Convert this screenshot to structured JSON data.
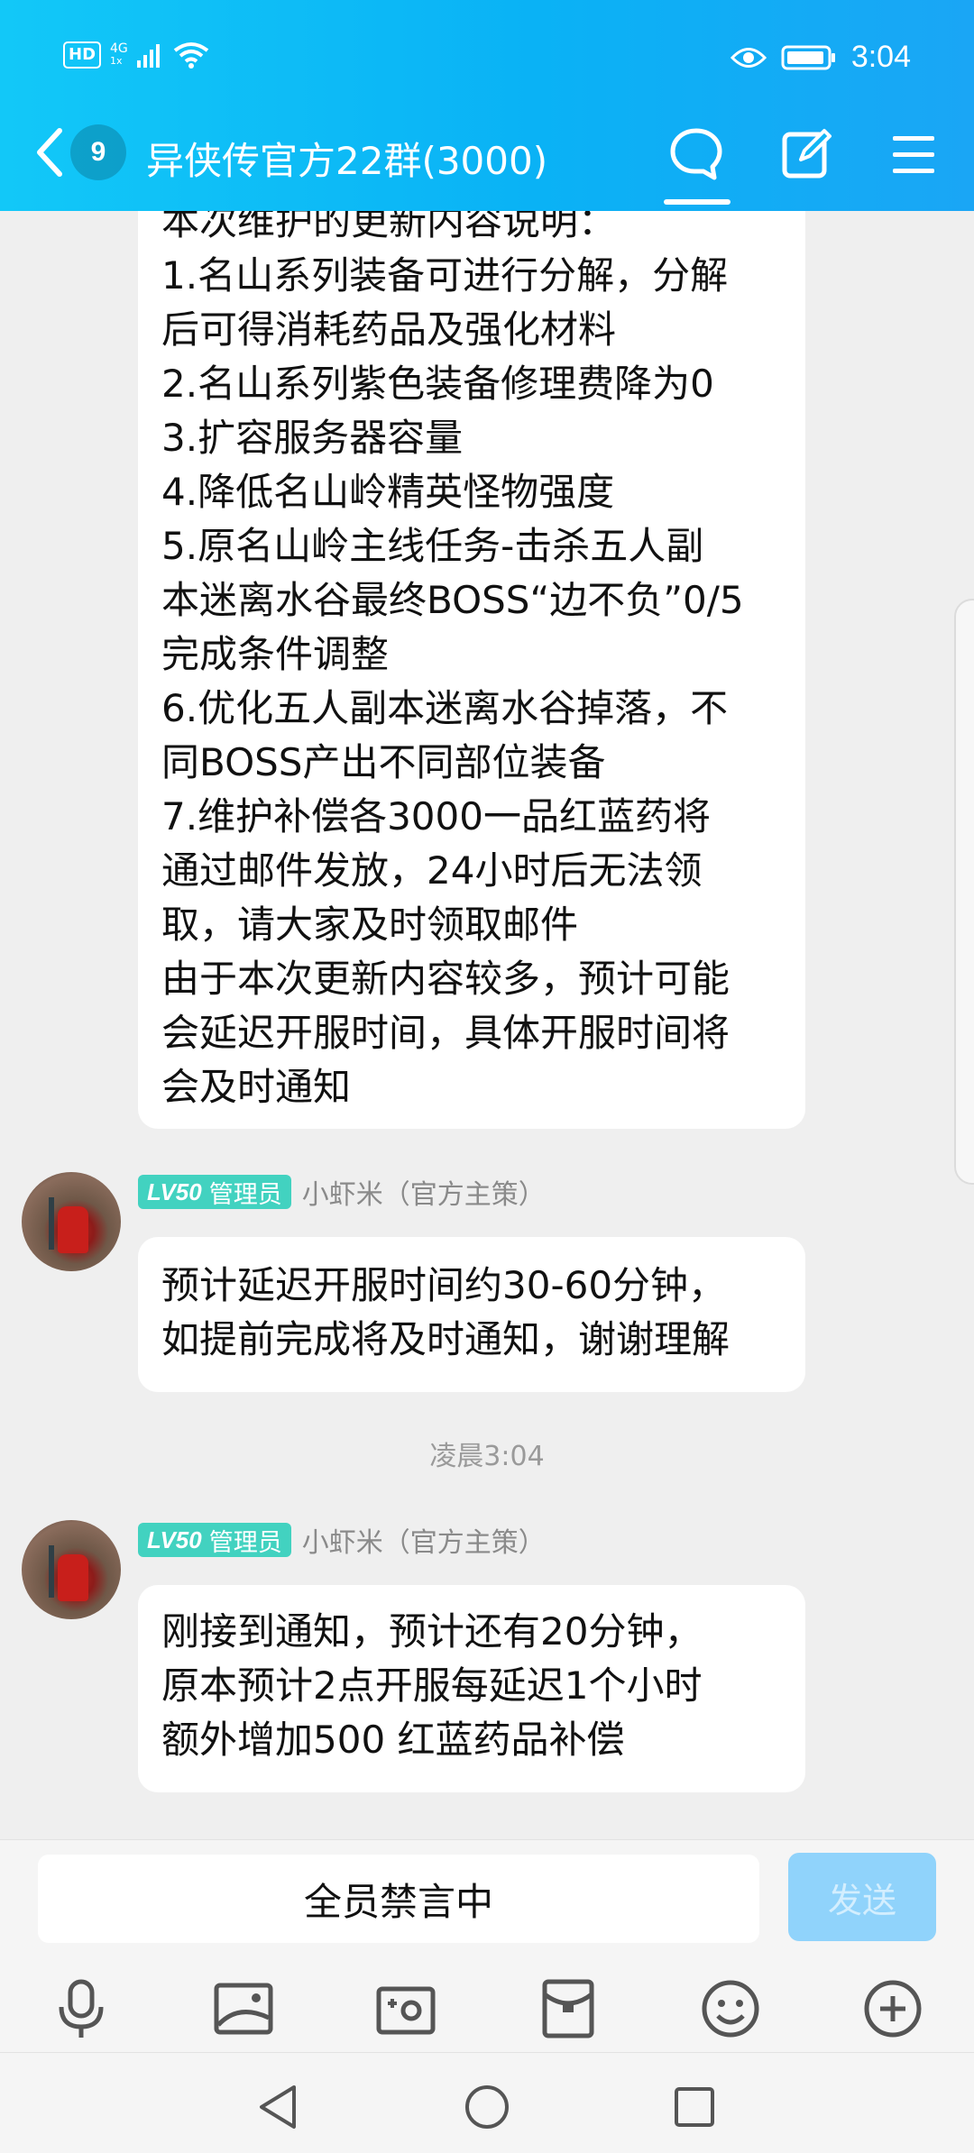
{
  "status_bar": {
    "hd": "HD",
    "network": "4G",
    "signal_sub": "1x",
    "time": "3:04"
  },
  "header": {
    "unread_count": "9",
    "title": "异侠传官方22群(3000)",
    "icons": [
      "back-icon",
      "chat-bubble-icon",
      "edit-icon",
      "menu-icon"
    ]
  },
  "messages": [
    {
      "text": "本次维护的更新内容说明：\n1.名山系列装备可进行分解，分解\n后可得消耗药品及强化材料\n2.名山系列紫色装备修理费降为0\n3.扩容服务器容量\n4.降低名山岭精英怪物强度\n5.原名山岭主线任务-击杀五人副\n本迷离水谷最终BOSS“边不负”0/5\n完成条件调整\n6.优化五人副本迷离水谷掉落，不\n同BOSS产出不同部位装备\n7.维护补偿各3000一品红蓝药将\n通过邮件发放，24小时后无法领\n取，请大家及时领取邮件\n由于本次更新内容较多，预计可能\n会延迟开服时间，具体开服时间将\n会及时通知"
    },
    {
      "level": "LV50",
      "role": "管理员",
      "sender": "小虾米（官方主策）",
      "text": "预计延迟开服时间约30-60分钟，\n如提前完成将及时通知，谢谢理解"
    },
    {
      "timestamp": "凌晨3:04"
    },
    {
      "level": "LV50",
      "role": "管理员",
      "sender": "小虾米（官方主策）",
      "text": "刚接到通知，预计还有20分钟，\n原本预计2点开服每延迟1个小时\n额外增加500 红蓝药品补偿"
    }
  ],
  "input": {
    "muted_text": "全员禁言中",
    "send_label": "发送"
  },
  "toolbar_icons": [
    "microphone-icon",
    "image-icon",
    "camera-icon",
    "red-packet-icon",
    "emoji-icon",
    "plus-icon"
  ],
  "nav_icons": [
    "nav-back-icon",
    "nav-home-icon",
    "nav-recents-icon"
  ],
  "colors": {
    "header_gradient_start": "#12c8f8",
    "header_gradient_end": "#1aa6f5",
    "admin_badge": "#42d2c0",
    "send_button_disabled": "#90d3fb",
    "chat_background": "#efefef"
  }
}
